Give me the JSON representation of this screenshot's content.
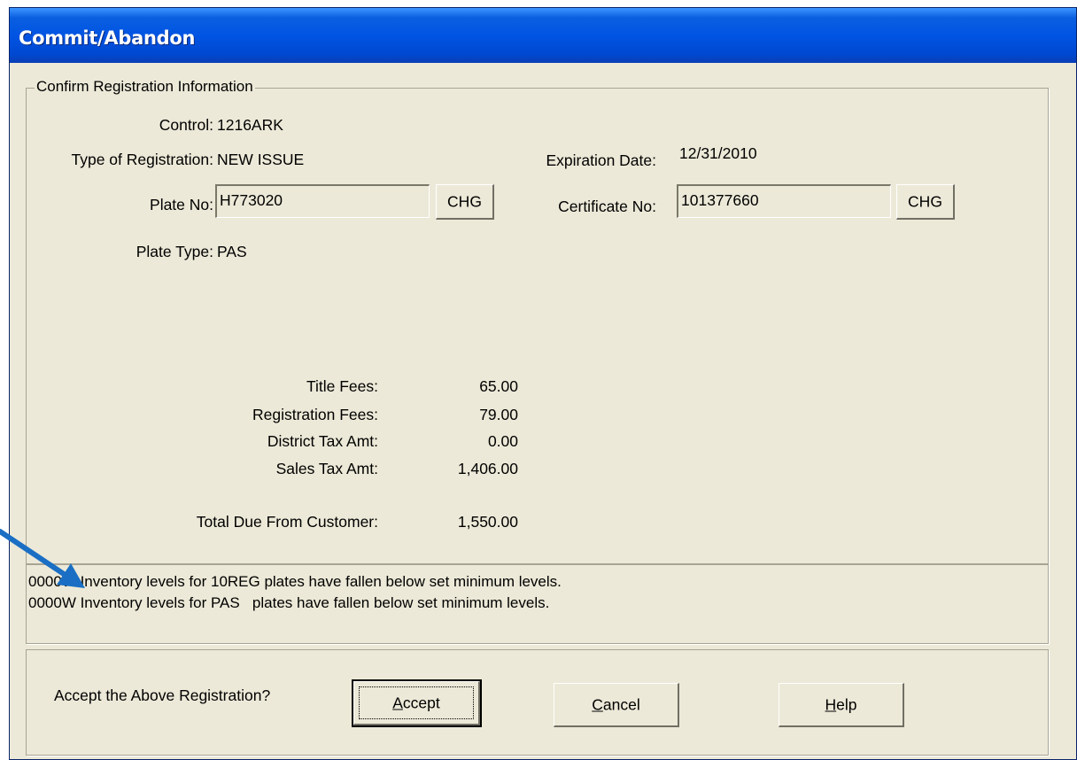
{
  "window": {
    "title": "Commit/Abandon"
  },
  "confirm": {
    "legend": "Confirm Registration Information",
    "control_label": "Control:",
    "control_value": "1216ARK",
    "type_label": "Type of Registration:",
    "type_value": "NEW ISSUE",
    "expiration_label": "Expiration Date:",
    "expiration_value": "12/31/2010",
    "plate_no_label": "Plate No:",
    "plate_no_value": "H773020",
    "plate_chg_label": "CHG",
    "certificate_label": "Certificate No:",
    "certificate_value": "101377660",
    "certificate_chg_label": "CHG",
    "plate_type_label": "Plate Type:",
    "plate_type_value": "PAS"
  },
  "fees": {
    "title_label": "Title Fees:",
    "title_value": "65.00",
    "registration_label": "Registration Fees:",
    "registration_value": "79.00",
    "district_label": "District Tax Amt:",
    "district_value": "0.00",
    "sales_label": "Sales Tax Amt:",
    "sales_value": "1,406.00",
    "total_label": "Total Due From Customer:",
    "total_value": "1,550.00"
  },
  "messages": [
    "0000W Inventory levels for 10REG plates have fallen below set minimum levels.",
    "0000W Inventory levels for PAS   plates have fallen below set minimum levels."
  ],
  "actions": {
    "prompt": "Accept the Above Registration?",
    "accept_mnemonic": "A",
    "accept_rest": "ccept",
    "cancel_mnemonic": "C",
    "cancel_rest": "ancel",
    "help_mnemonic": "H",
    "help_rest": "elp"
  },
  "colors": {
    "titlebar": "#0054e3",
    "face": "#ece9d8",
    "annotation_arrow": "#1a6fc4"
  }
}
